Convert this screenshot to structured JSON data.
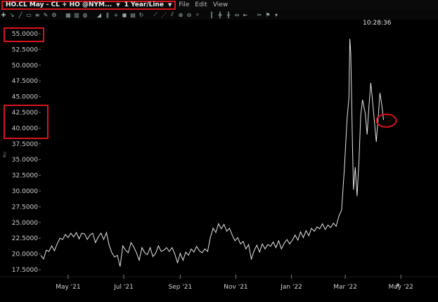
{
  "window": {
    "symbol": "HO.CL May - CL + HO @NYM...",
    "timeframe": "1 Year/Line",
    "symbol_caret": "▼",
    "timeframe_caret": "▼"
  },
  "menu": {
    "items": [
      "File",
      "Edit",
      "View"
    ]
  },
  "toolbar": {
    "icons": [
      "crosshair-icon",
      "arrow-icon",
      "line-tool-icon",
      "rectangle-icon",
      "fib-icon",
      "draw-icon",
      "gear-icon",
      "separator",
      "bar-chart-icon",
      "candle-icon",
      "settings-icon",
      "separator",
      "cursor-icon",
      "bars-icon",
      "add-icon",
      "color-icon",
      "table-icon",
      "refresh-icon",
      "separator",
      "trend-icon",
      "multi-line-icon",
      "channel-icon",
      "zoom-in-icon",
      "zoom-out-icon",
      "magnify-icon",
      "separator",
      "bar-width-icon",
      "bar-narrow-icon",
      "bar-wide-icon",
      "fit-icon",
      "scroll-icon",
      "separator",
      "tools-icon",
      "flag-icon",
      "arrow-down-icon"
    ]
  },
  "status": {
    "time": "10:28:36"
  },
  "annotations": {
    "highlight_color": "#d8141c"
  },
  "colors": {
    "line": "#e6e6e6",
    "background": "#000000",
    "axis_text": "#cfcfcf"
  },
  "chart_data": {
    "type": "line",
    "title": "",
    "xlabel": "",
    "ylabel": "Prc",
    "ylim": [
      15.0,
      57.5
    ],
    "yticks": [
      "55.0000",
      "52.5000",
      "50.0000",
      "47.5000",
      "45.0000",
      "42.5000",
      "40.0000",
      "37.5000",
      "35.0000",
      "32.5000",
      "30.0000",
      "27.5000",
      "25.0000",
      "22.5000",
      "20.0000",
      "17.5000"
    ],
    "ytick_values": [
      55.0,
      52.5,
      50.0,
      47.5,
      45.0,
      42.5,
      40.0,
      37.5,
      35.0,
      32.5,
      30.0,
      27.5,
      25.0,
      22.5,
      20.0,
      17.5
    ],
    "xticks": [
      "May '21",
      "Jul '21",
      "Sep '21",
      "Nov '21",
      "Jan '22",
      "Mar '22",
      "May '22"
    ],
    "xtick_dates": [
      "2021-05-01",
      "2021-07-01",
      "2021-09-01",
      "2021-11-01",
      "2022-01-01",
      "2022-03-01",
      "2022-05-01"
    ],
    "xlim": [
      "2021-04-01",
      "2022-05-24"
    ],
    "grid": false,
    "series": [
      {
        "points": [
          [
            "2021-04-01",
            19.8
          ],
          [
            "2021-04-04",
            19.2
          ],
          [
            "2021-04-07",
            20.6
          ],
          [
            "2021-04-10",
            20.4
          ],
          [
            "2021-04-13",
            21.3
          ],
          [
            "2021-04-16",
            20.5
          ],
          [
            "2021-04-19",
            21.6
          ],
          [
            "2021-04-22",
            22.5
          ],
          [
            "2021-04-25",
            22.3
          ],
          [
            "2021-04-28",
            23.1
          ],
          [
            "2021-05-01",
            22.6
          ],
          [
            "2021-05-04",
            23.3
          ],
          [
            "2021-05-07",
            22.7
          ],
          [
            "2021-05-10",
            23.4
          ],
          [
            "2021-05-13",
            22.4
          ],
          [
            "2021-05-16",
            23.3
          ],
          [
            "2021-05-19",
            23.2
          ],
          [
            "2021-05-22",
            22.3
          ],
          [
            "2021-05-25",
            23.0
          ],
          [
            "2021-05-28",
            23.3
          ],
          [
            "2021-05-31",
            21.8
          ],
          [
            "2021-06-03",
            22.7
          ],
          [
            "2021-06-06",
            23.3
          ],
          [
            "2021-06-09",
            22.3
          ],
          [
            "2021-06-12",
            23.4
          ],
          [
            "2021-06-15",
            21.4
          ],
          [
            "2021-06-18",
            20.2
          ],
          [
            "2021-06-21",
            19.5
          ],
          [
            "2021-06-24",
            19.8
          ],
          [
            "2021-06-27",
            18.0
          ],
          [
            "2021-06-30",
            21.3
          ],
          [
            "2021-07-03",
            20.6
          ],
          [
            "2021-07-06",
            20.2
          ],
          [
            "2021-07-09",
            21.8
          ],
          [
            "2021-07-12",
            21.1
          ],
          [
            "2021-07-15",
            20.2
          ],
          [
            "2021-07-18",
            19.0
          ],
          [
            "2021-07-21",
            21.0
          ],
          [
            "2021-07-24",
            20.2
          ],
          [
            "2021-07-27",
            19.9
          ],
          [
            "2021-07-30",
            21.0
          ],
          [
            "2021-08-02",
            19.6
          ],
          [
            "2021-08-05",
            20.1
          ],
          [
            "2021-08-08",
            21.3
          ],
          [
            "2021-08-11",
            20.4
          ],
          [
            "2021-08-14",
            20.6
          ],
          [
            "2021-08-17",
            21.0
          ],
          [
            "2021-08-20",
            20.4
          ],
          [
            "2021-08-23",
            21.0
          ],
          [
            "2021-08-26",
            20.0
          ],
          [
            "2021-08-29",
            18.6
          ],
          [
            "2021-09-01",
            20.1
          ],
          [
            "2021-09-04",
            19.0
          ],
          [
            "2021-09-07",
            20.3
          ],
          [
            "2021-09-10",
            19.8
          ],
          [
            "2021-09-13",
            20.8
          ],
          [
            "2021-09-16",
            20.3
          ],
          [
            "2021-09-19",
            21.2
          ],
          [
            "2021-09-22",
            20.5
          ],
          [
            "2021-09-25",
            20.2
          ],
          [
            "2021-09-28",
            20.8
          ],
          [
            "2021-10-01",
            20.4
          ],
          [
            "2021-10-04",
            22.6
          ],
          [
            "2021-10-07",
            24.1
          ],
          [
            "2021-10-10",
            23.4
          ],
          [
            "2021-10-13",
            24.8
          ],
          [
            "2021-10-16",
            24.0
          ],
          [
            "2021-10-19",
            24.7
          ],
          [
            "2021-10-22",
            23.6
          ],
          [
            "2021-10-25",
            24.1
          ],
          [
            "2021-10-28",
            23.0
          ],
          [
            "2021-10-31",
            22.1
          ],
          [
            "2021-11-03",
            22.6
          ],
          [
            "2021-11-06",
            21.6
          ],
          [
            "2021-11-09",
            22.0
          ],
          [
            "2021-11-12",
            20.8
          ],
          [
            "2021-11-15",
            21.5
          ],
          [
            "2021-11-18",
            19.2
          ],
          [
            "2021-11-21",
            20.5
          ],
          [
            "2021-11-24",
            21.4
          ],
          [
            "2021-11-27",
            20.3
          ],
          [
            "2021-11-30",
            21.6
          ],
          [
            "2021-12-03",
            20.8
          ],
          [
            "2021-12-06",
            21.5
          ],
          [
            "2021-12-09",
            21.2
          ],
          [
            "2021-12-12",
            21.9
          ],
          [
            "2021-12-15",
            21.0
          ],
          [
            "2021-12-18",
            22.1
          ],
          [
            "2021-12-21",
            20.8
          ],
          [
            "2021-12-24",
            21.7
          ],
          [
            "2021-12-27",
            22.3
          ],
          [
            "2021-12-30",
            21.6
          ],
          [
            "2022-01-02",
            22.2
          ],
          [
            "2022-01-05",
            23.0
          ],
          [
            "2022-01-08",
            22.2
          ],
          [
            "2022-01-11",
            23.5
          ],
          [
            "2022-01-14",
            22.6
          ],
          [
            "2022-01-17",
            23.7
          ],
          [
            "2022-01-20",
            22.9
          ],
          [
            "2022-01-23",
            24.1
          ],
          [
            "2022-01-26",
            23.6
          ],
          [
            "2022-01-29",
            24.3
          ],
          [
            "2022-02-01",
            24.0
          ],
          [
            "2022-02-04",
            24.8
          ],
          [
            "2022-02-07",
            23.9
          ],
          [
            "2022-02-10",
            24.6
          ],
          [
            "2022-02-13",
            24.2
          ],
          [
            "2022-02-16",
            24.9
          ],
          [
            "2022-02-19",
            24.4
          ],
          [
            "2022-02-22",
            26.0
          ],
          [
            "2022-02-25",
            27.0
          ],
          [
            "2022-02-28",
            33.5
          ],
          [
            "2022-03-03",
            41.5
          ],
          [
            "2022-03-05",
            44.8
          ],
          [
            "2022-03-06",
            54.2
          ],
          [
            "2022-03-07",
            52.0
          ],
          [
            "2022-03-09",
            36.5
          ],
          [
            "2022-03-10",
            30.2
          ],
          [
            "2022-03-12",
            33.8
          ],
          [
            "2022-03-14",
            29.2
          ],
          [
            "2022-03-16",
            34.5
          ],
          [
            "2022-03-18",
            42.0
          ],
          [
            "2022-03-20",
            44.5
          ],
          [
            "2022-03-22",
            43.0
          ],
          [
            "2022-03-23",
            42.3
          ],
          [
            "2022-03-25",
            39.0
          ],
          [
            "2022-03-27",
            43.5
          ],
          [
            "2022-03-29",
            47.2
          ],
          [
            "2022-03-31",
            44.2
          ],
          [
            "2022-04-02",
            41.0
          ],
          [
            "2022-04-04",
            37.8
          ],
          [
            "2022-04-06",
            41.5
          ],
          [
            "2022-04-08",
            45.6
          ],
          [
            "2022-04-10",
            43.8
          ],
          [
            "2022-04-12",
            41.3
          ]
        ]
      }
    ]
  }
}
